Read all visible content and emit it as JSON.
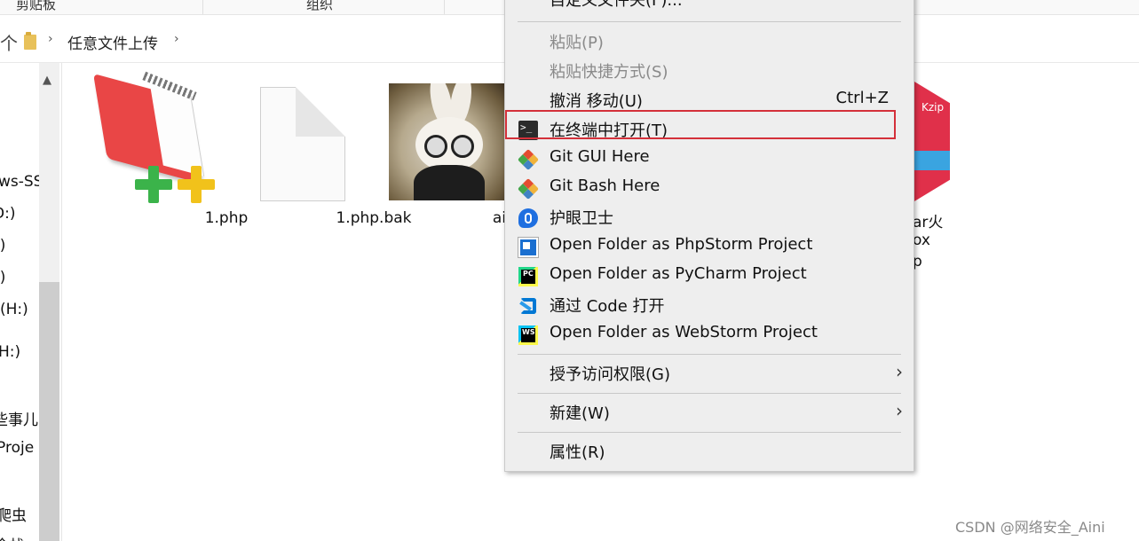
{
  "ribbon": {
    "group_clipboard": "剪贴板",
    "group_organize": "组织"
  },
  "address_bar": {
    "up_label": "个",
    "separator": "›",
    "breadcrumb": "任意文件上传"
  },
  "nav_pane": {
    "items": [
      "ws-SS",
      "D:)",
      ":)",
      ":)",
      " (H:)",
      "H:)",
      "些事儿",
      "Proje",
      "爬虫",
      "全栈"
    ]
  },
  "files": [
    {
      "name": "1.php",
      "icon": "notepad-plus-plus-icon"
    },
    {
      "name": "1.php.bak",
      "icon": "blank-document-icon"
    },
    {
      "name": "aini.jpg",
      "icon": "image-thumbnail"
    }
  ],
  "partial_file": {
    "icon": "7zip-archive-icon",
    "icon_text": "Kzip",
    "line1": "ar火",
    "line2": "ox",
    "line3": "p"
  },
  "context_menu": {
    "top_clipped": "自定义文件夹(F)...",
    "items": [
      {
        "label": "粘贴(P)",
        "disabled": true
      },
      {
        "label": "粘贴快捷方式(S)",
        "disabled": true
      },
      {
        "label": "撤消 移动(U)",
        "shortcut": "Ctrl+Z"
      },
      {
        "label": "在终端中打开(T)",
        "icon": "terminal-icon"
      },
      {
        "label": "Git GUI Here",
        "icon": "git-icon"
      },
      {
        "label": "Git Bash Here",
        "icon": "git-icon"
      },
      {
        "label": "护眼卫士",
        "icon": "eye-guard-icon"
      },
      {
        "label": "Open Folder as PhpStorm Project",
        "icon": "phpstorm-icon"
      },
      {
        "label": "Open Folder as PyCharm Project",
        "icon": "pycharm-icon"
      },
      {
        "label": "通过 Code 打开",
        "icon": "vscode-icon"
      },
      {
        "label": "Open Folder as WebStorm Project",
        "icon": "webstorm-icon"
      },
      {
        "label": "授予访问权限(G)",
        "submenu": true
      },
      {
        "label": "新建(W)",
        "submenu": true
      },
      {
        "label": "属性(R)"
      }
    ],
    "submenu_arrow": "›"
  },
  "watermark": "CSDN @网络安全_Aini",
  "colors": {
    "menu_bg": "#eeeeee",
    "highlight_border": "#d4303a",
    "disabled_text": "#8a8a8a"
  }
}
